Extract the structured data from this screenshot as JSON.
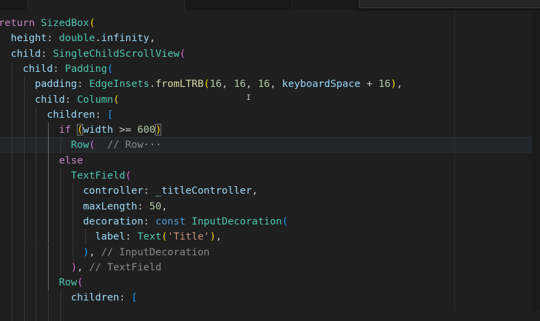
{
  "editor": {
    "language": "dart",
    "lines": [
      [
        {
          "t": "return ",
          "c": "kw"
        },
        {
          "t": "SizedBox",
          "c": "ty"
        },
        {
          "t": "(",
          "c": "b1"
        }
      ],
      [
        {
          "t": "  height",
          "c": "pr"
        },
        {
          "t": ": ",
          "c": "pn"
        },
        {
          "t": "double",
          "c": "ty"
        },
        {
          "t": ".",
          "c": "pn"
        },
        {
          "t": "infinity",
          "c": "pr"
        },
        {
          "t": ",",
          "c": "pn"
        }
      ],
      [
        {
          "t": "  child",
          "c": "pr"
        },
        {
          "t": ": ",
          "c": "pn"
        },
        {
          "t": "SingleChildScrollView",
          "c": "ty"
        },
        {
          "t": "(",
          "c": "b2"
        }
      ],
      [
        {
          "t": "    child",
          "c": "pr"
        },
        {
          "t": ": ",
          "c": "pn"
        },
        {
          "t": "Padding",
          "c": "ty"
        },
        {
          "t": "(",
          "c": "b3"
        }
      ],
      [
        {
          "t": "      padding",
          "c": "pr"
        },
        {
          "t": ": ",
          "c": "pn"
        },
        {
          "t": "EdgeInsets",
          "c": "ty"
        },
        {
          "t": ".",
          "c": "pn"
        },
        {
          "t": "fromLTRB",
          "c": "fn"
        },
        {
          "t": "(",
          "c": "b1"
        },
        {
          "t": "16",
          "c": "nu"
        },
        {
          "t": ", ",
          "c": "pn"
        },
        {
          "t": "16",
          "c": "nu"
        },
        {
          "t": ", ",
          "c": "pn"
        },
        {
          "t": "16",
          "c": "nu"
        },
        {
          "t": ", ",
          "c": "pn"
        },
        {
          "t": "keyboardSpace",
          "c": "pr"
        },
        {
          "t": " + ",
          "c": "pn"
        },
        {
          "t": "16",
          "c": "nu"
        },
        {
          "t": ")",
          "c": "b1"
        },
        {
          "t": ",",
          "c": "pn"
        }
      ],
      [
        {
          "t": "      child",
          "c": "pr"
        },
        {
          "t": ": ",
          "c": "pn"
        },
        {
          "t": "Column",
          "c": "ty"
        },
        {
          "t": "(",
          "c": "b1"
        }
      ],
      [
        {
          "t": "        children",
          "c": "pr"
        },
        {
          "t": ": ",
          "c": "pn"
        },
        {
          "t": "[",
          "c": "b3"
        }
      ],
      [
        {
          "t": "          if ",
          "c": "kw"
        },
        {
          "t": "(",
          "c": "b1 bm"
        },
        {
          "t": "width",
          "c": "pr"
        },
        {
          "t": " >= ",
          "c": "pn"
        },
        {
          "t": "600",
          "c": "nu"
        },
        {
          "t": ")",
          "c": "b1 bm"
        }
      ],
      [
        {
          "t": "            Row",
          "c": "ty"
        },
        {
          "t": "(",
          "c": "b2"
        },
        {
          "t": "  // Row",
          "c": "cmg"
        },
        {
          "t": "···",
          "c": "ell"
        }
      ],
      [
        {
          "t": "          else",
          "c": "kw"
        }
      ],
      [
        {
          "t": "            TextField",
          "c": "ty"
        },
        {
          "t": "(",
          "c": "b2"
        }
      ],
      [
        {
          "t": "              controller",
          "c": "pr"
        },
        {
          "t": ": ",
          "c": "pn"
        },
        {
          "t": "_titleController",
          "c": "pr"
        },
        {
          "t": ",",
          "c": "pn"
        }
      ],
      [
        {
          "t": "              maxLength",
          "c": "pr"
        },
        {
          "t": ": ",
          "c": "pn"
        },
        {
          "t": "50",
          "c": "nu"
        },
        {
          "t": ",",
          "c": "pn"
        }
      ],
      [
        {
          "t": "              decoration",
          "c": "pr"
        },
        {
          "t": ": ",
          "c": "pn"
        },
        {
          "t": "const ",
          "c": "kb"
        },
        {
          "t": "InputDecoration",
          "c": "ty"
        },
        {
          "t": "(",
          "c": "b3"
        }
      ],
      [
        {
          "t": "                label",
          "c": "pr"
        },
        {
          "t": ": ",
          "c": "pn"
        },
        {
          "t": "Text",
          "c": "ty"
        },
        {
          "t": "(",
          "c": "b1"
        },
        {
          "t": "'Title'",
          "c": "st"
        },
        {
          "t": ")",
          "c": "b1"
        },
        {
          "t": ",",
          "c": "pn"
        }
      ],
      [
        {
          "t": "              )",
          "c": "b3"
        },
        {
          "t": ", ",
          "c": "pn"
        },
        {
          "t": "// InputDecoration",
          "c": "cmg"
        }
      ],
      [
        {
          "t": "            )",
          "c": "b2"
        },
        {
          "t": ", ",
          "c": "pn"
        },
        {
          "t": "// TextField",
          "c": "cmg"
        }
      ],
      [
        {
          "t": "          Row",
          "c": "ty"
        },
        {
          "t": "(",
          "c": "b2"
        }
      ],
      [
        {
          "t": "            children",
          "c": "pr"
        },
        {
          "t": ": ",
          "c": "pn"
        },
        {
          "t": "[",
          "c": "b3"
        }
      ],
      [
        {
          "t": "              ",
          "c": "pn"
        }
      ]
    ],
    "current_line": 8,
    "cursor_glyph": "I"
  },
  "colors": {
    "background": "#1f1f1f",
    "keyword": "#c586c0",
    "type": "#4ec9b0",
    "function": "#dcdcaa",
    "property": "#9cdcfe",
    "number": "#b5cea8",
    "string": "#ce9178",
    "closing_comment": "#8b8b8b",
    "bracket_gold": "#ffd700",
    "bracket_orchid": "#da70d6",
    "bracket_blue": "#179fff"
  }
}
